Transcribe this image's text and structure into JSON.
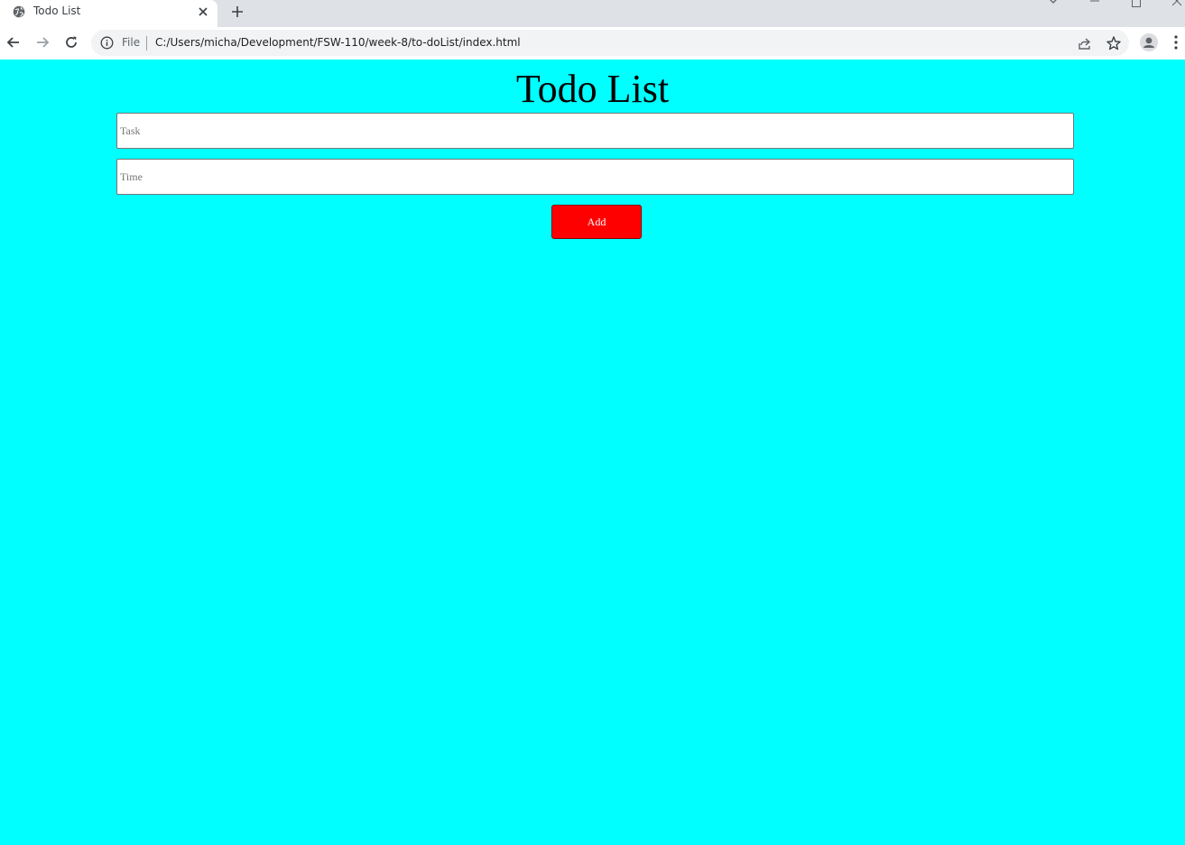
{
  "browser": {
    "tab_title": "Todo List",
    "address_scheme": "File",
    "address_url": "C:/Users/micha/Development/FSW-110/week-8/to-doList/index.html"
  },
  "page": {
    "heading": "Todo List",
    "task_placeholder": "Task",
    "time_placeholder": "Time",
    "add_label": "Add"
  },
  "colors": {
    "page_background": "#00ffff",
    "add_button": "#ff0000",
    "add_button_text": "#ffffff"
  }
}
